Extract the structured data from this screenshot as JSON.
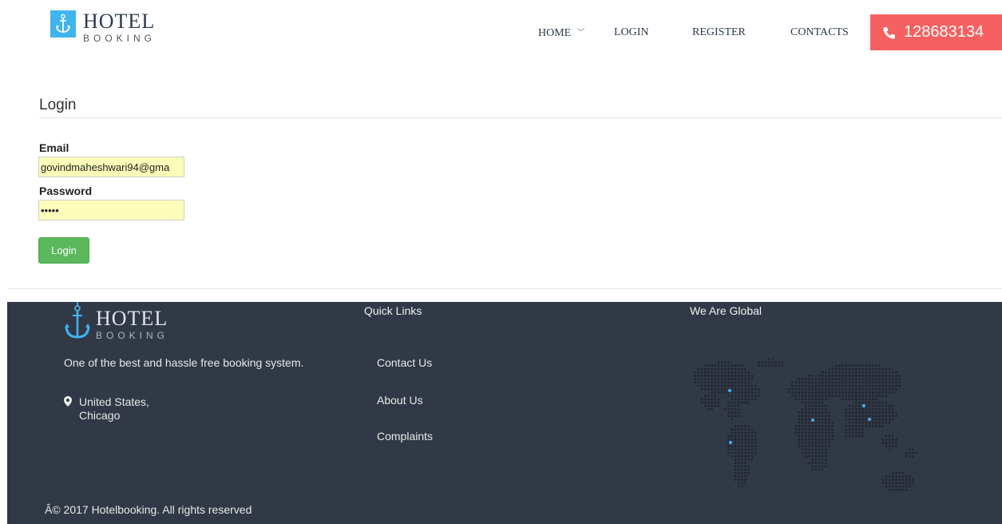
{
  "brand": {
    "title": "HOTEL",
    "subtitle": "BOOKING"
  },
  "nav": {
    "home": "HOME",
    "login": "LOGIN",
    "register": "REGISTER",
    "contacts": "CONTACTS"
  },
  "phone": {
    "number": "128683134"
  },
  "login": {
    "heading": "Login",
    "email_label": "Email",
    "email_value": "govindmaheshwari94@gma",
    "password_label": "Password",
    "password_value": "•••••",
    "button_label": "Login"
  },
  "footer": {
    "tagline": "One of the best and hassle free booking system.",
    "location_line1": "United States,",
    "location_line2": "Chicago",
    "quick_links_title": "Quick Links",
    "links": [
      "Contact Us",
      "About Us",
      "Complaints"
    ],
    "global_title": "We Are Global",
    "copyright": "Â© 2017 Hotelbooking. All rights reserved"
  },
  "colors": {
    "accent_blue": "#3fb4ee",
    "phone_red": "#f66060",
    "button_green": "#5cb85c",
    "footer_bg": "#313946",
    "input_bg": "#fbfdb9"
  }
}
